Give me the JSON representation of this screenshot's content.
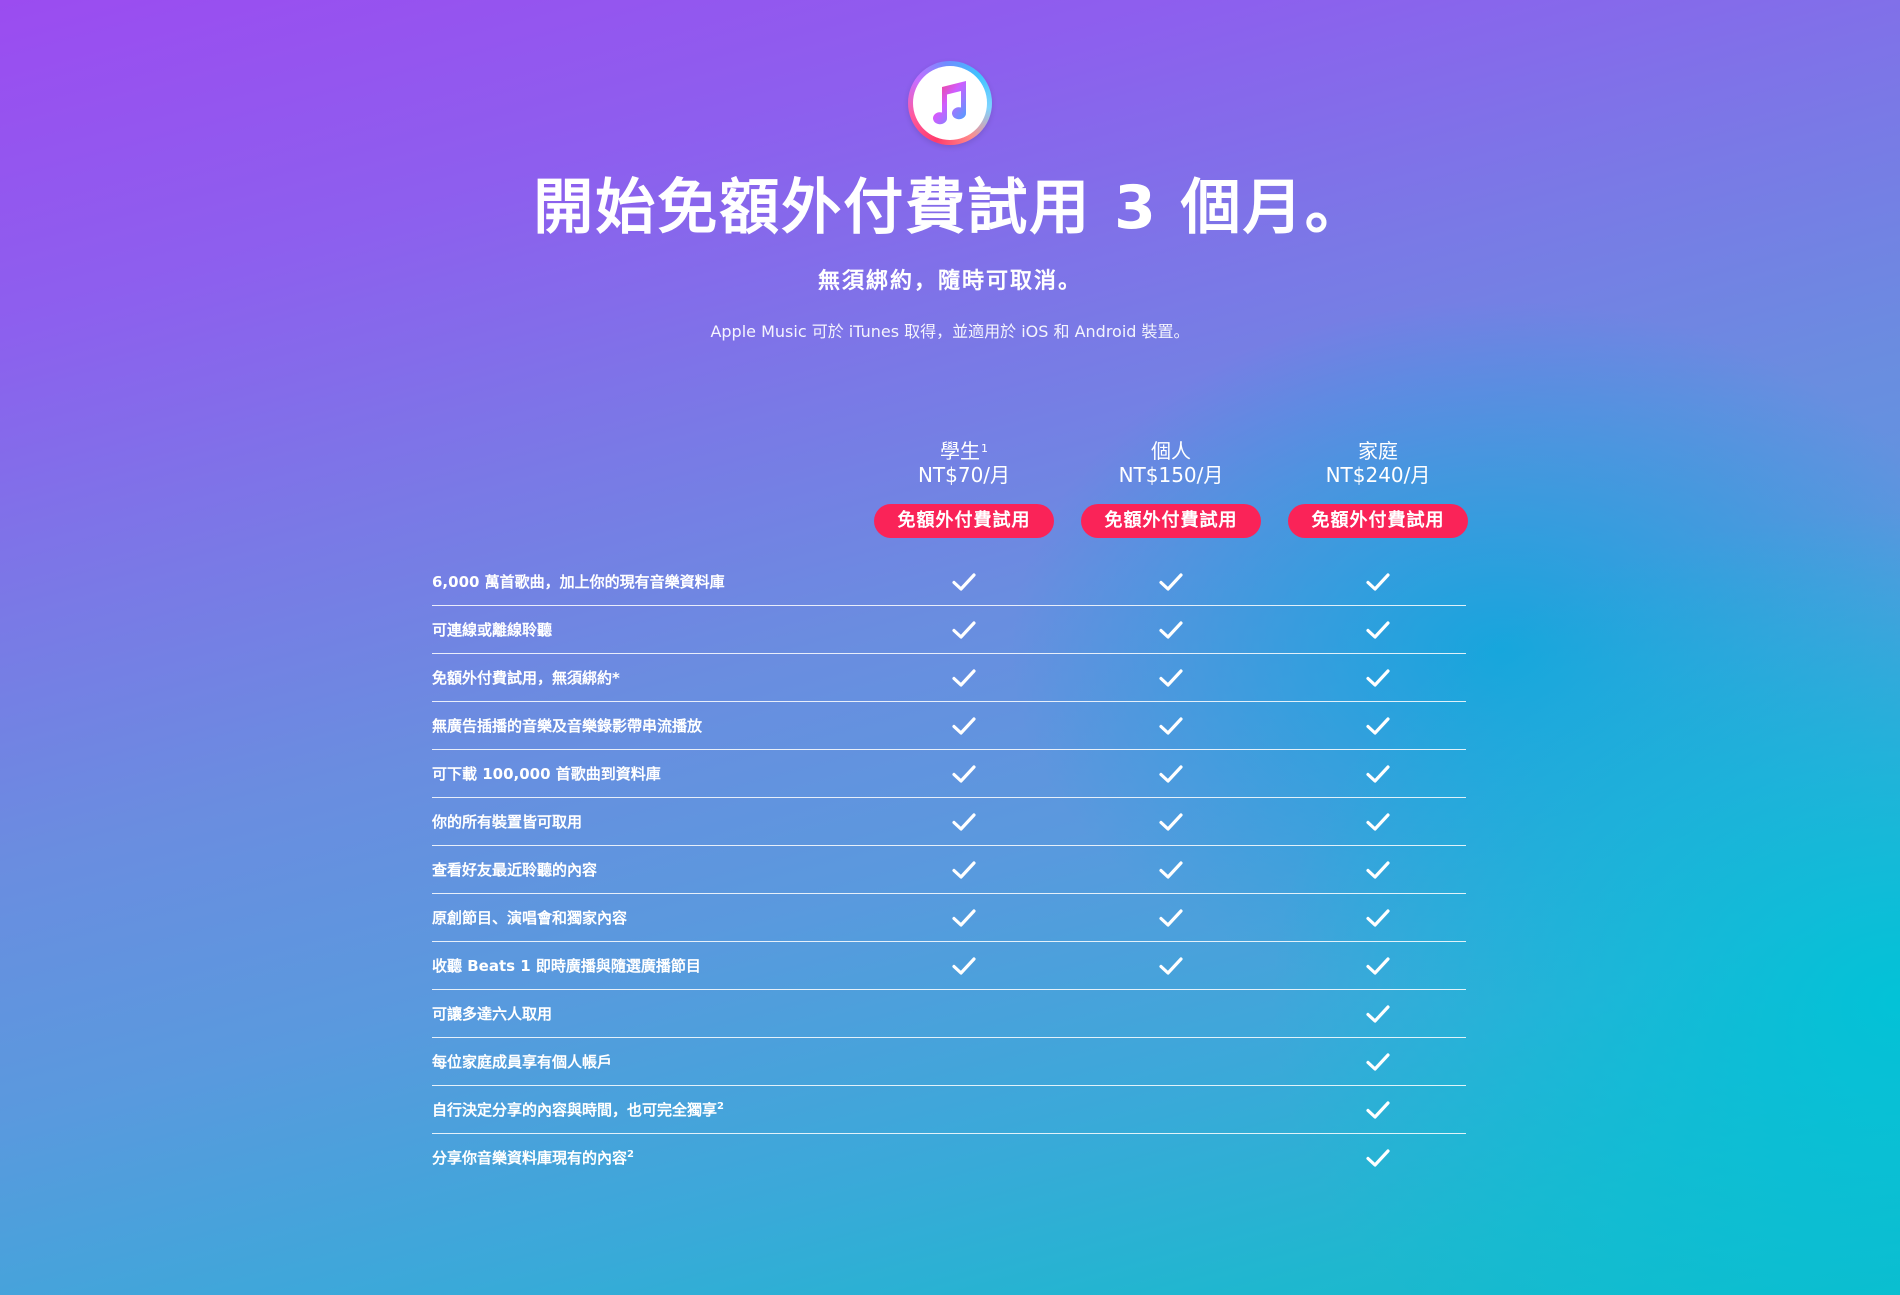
{
  "header": {
    "logo_icon": "music-note-icon",
    "headline": "開始免額外付費試用 3 個月。",
    "subhead": "無須綁約，隨時可取消。",
    "note": "Apple Music 可於 iTunes 取得，並適用於 iOS 和 Android 裝置。"
  },
  "plans": [
    {
      "name": "學生",
      "footnote": "1",
      "price": "NT$70/月",
      "button": "免額外付費試用"
    },
    {
      "name": "個人",
      "footnote": "",
      "price": "NT$150/月",
      "button": "免額外付費試用"
    },
    {
      "name": "家庭",
      "footnote": "",
      "price": "NT$240/月",
      "button": "免額外付費試用"
    }
  ],
  "features": [
    {
      "label": "6,000 萬首歌曲，加上你的現有音樂資料庫",
      "footnote": "",
      "included": [
        true,
        true,
        true
      ]
    },
    {
      "label": "可連線或離線聆聽",
      "footnote": "",
      "included": [
        true,
        true,
        true
      ]
    },
    {
      "label": "免額外付費試用，無須綁約*",
      "footnote": "",
      "included": [
        true,
        true,
        true
      ]
    },
    {
      "label": "無廣告插播的音樂及音樂錄影帶串流播放",
      "footnote": "",
      "included": [
        true,
        true,
        true
      ]
    },
    {
      "label": "可下載 100,000 首歌曲到資料庫",
      "footnote": "",
      "included": [
        true,
        true,
        true
      ]
    },
    {
      "label": "你的所有裝置皆可取用",
      "footnote": "",
      "included": [
        true,
        true,
        true
      ]
    },
    {
      "label": "查看好友最近聆聽的內容",
      "footnote": "",
      "included": [
        true,
        true,
        true
      ]
    },
    {
      "label": "原創節目、演唱會和獨家內容",
      "footnote": "",
      "included": [
        true,
        true,
        true
      ]
    },
    {
      "label": "收聽 Beats 1 即時廣播與隨選廣播節目",
      "footnote": "",
      "included": [
        true,
        true,
        true
      ]
    },
    {
      "label": "可讓多達六人取用",
      "footnote": "",
      "included": [
        false,
        false,
        true
      ]
    },
    {
      "label": "每位家庭成員享有個人帳戶",
      "footnote": "",
      "included": [
        false,
        false,
        true
      ]
    },
    {
      "label": "自行決定分享的內容與時間，也可完全獨享",
      "footnote": "2",
      "included": [
        false,
        false,
        true
      ]
    },
    {
      "label": "分享你音樂資料庫現有的內容",
      "footnote": "2",
      "included": [
        false,
        false,
        true
      ]
    }
  ],
  "colors": {
    "accent_button": "#fa2358",
    "text": "#ffffff",
    "gradient_top": "#9b4cf0",
    "gradient_bottom": "#10bccc"
  },
  "icons": {
    "check": "checkmark-icon"
  }
}
